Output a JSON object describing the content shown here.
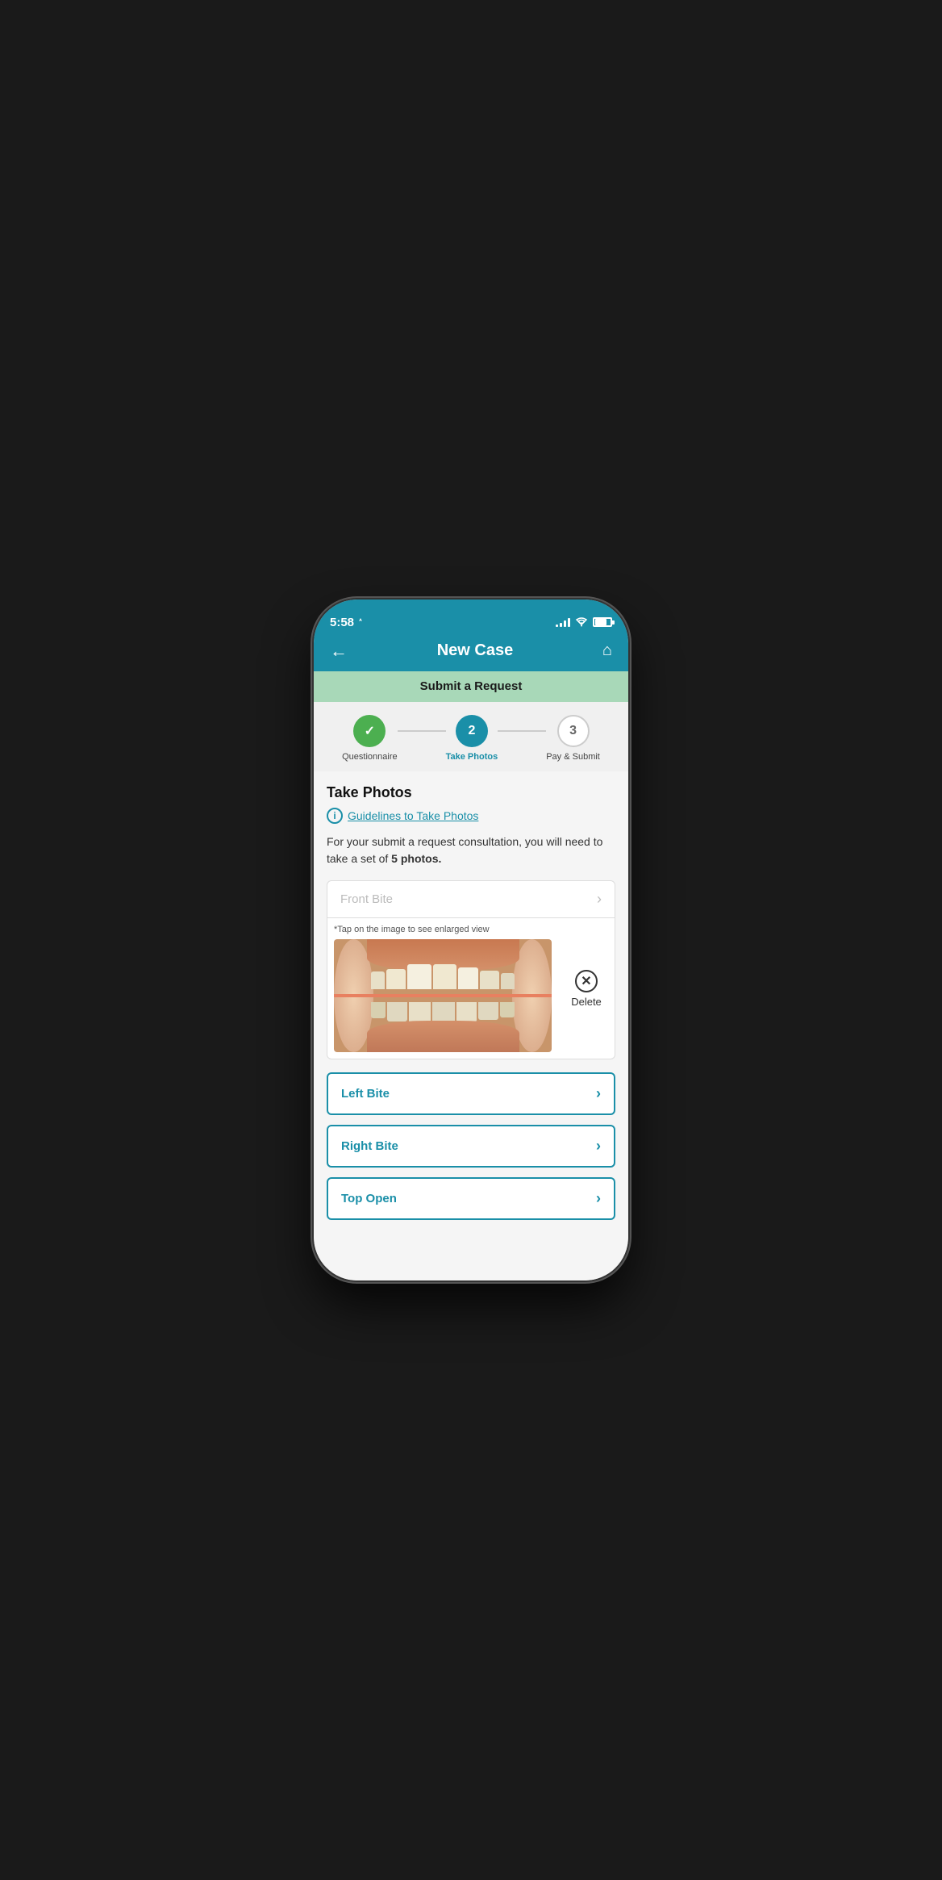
{
  "status_bar": {
    "time": "5:58",
    "location_icon": "◁",
    "signal_bars": [
      3,
      6,
      8,
      11,
      14
    ],
    "battery_level": 55
  },
  "header": {
    "back_label": "←",
    "title": "New Case",
    "home_label": "⌂"
  },
  "sub_header": {
    "text": "Submit a Request"
  },
  "steps": [
    {
      "number": "✓",
      "label": "Questionnaire",
      "state": "done"
    },
    {
      "number": "2",
      "label": "Take Photos",
      "state": "active"
    },
    {
      "number": "3",
      "label": "Pay & Submit",
      "state": "inactive"
    }
  ],
  "main": {
    "section_title": "Take Photos",
    "guidelines_link": "Guidelines to Take Photos",
    "description": "For your submit a request consultation, you will need to take a set of ",
    "description_bold": "5 photos.",
    "photos": [
      {
        "label": "Front Bite",
        "state": "uploaded",
        "tap_hint": "*Tap on the image to see enlarged view",
        "delete_label": "Delete"
      },
      {
        "label": "Left Bite",
        "state": "empty"
      },
      {
        "label": "Right Bite",
        "state": "empty"
      },
      {
        "label": "Top Open",
        "state": "empty"
      }
    ]
  }
}
